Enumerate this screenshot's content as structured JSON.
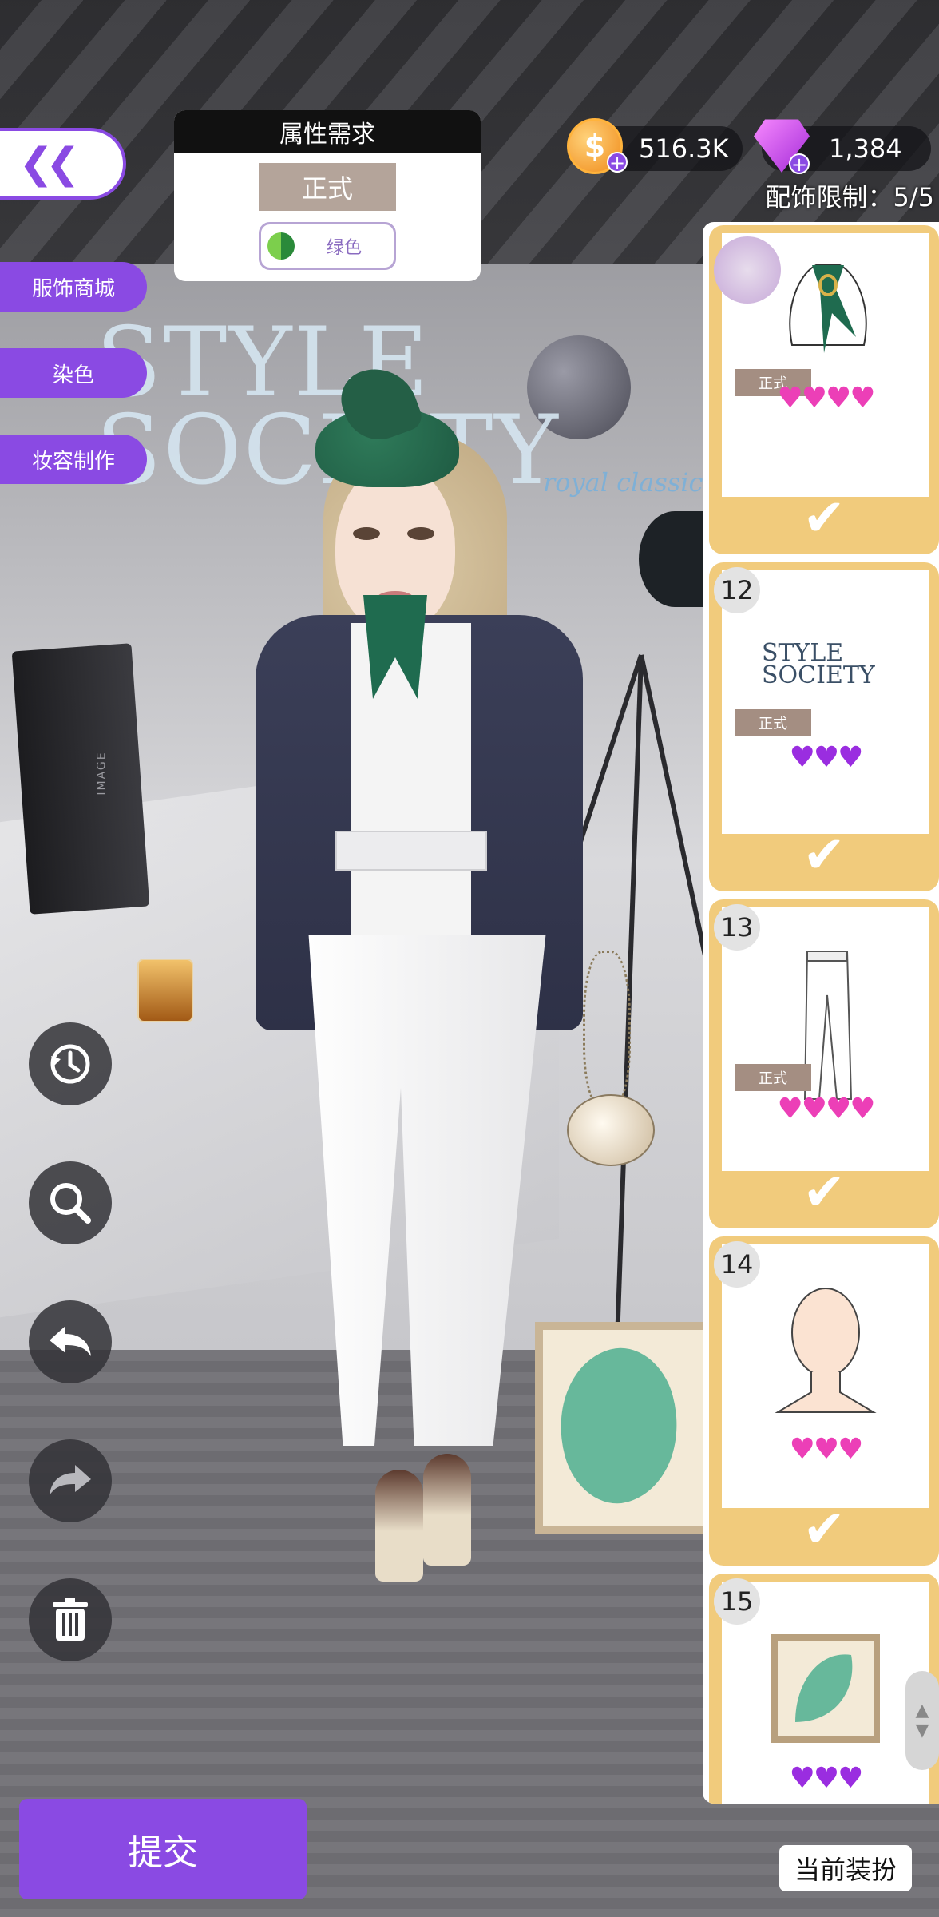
{
  "top_bar": {
    "coins": "516.3K",
    "gems": "1,384",
    "accessory_limit": "配饰限制：5/5"
  },
  "attribute_panel": {
    "title": "属性需求",
    "style_tag": "正式",
    "color_label": "绿色"
  },
  "side_menu": {
    "shop": "服饰商城",
    "dye": "染色",
    "makeup": "妆容制作"
  },
  "background": {
    "logo_line1": "STYLE",
    "logo_line2": "SOCIETY",
    "logo_script": "royal classic",
    "softbox_label": "IMAGE"
  },
  "items": [
    {
      "number": "",
      "tag": "正式",
      "hearts": "♥♥♥♥",
      "heart_color": "pink",
      "selected": true,
      "icon": "scarf-icon"
    },
    {
      "number": "12",
      "tag": "正式",
      "hearts": "♥♥♥",
      "heart_color": "purple",
      "selected": true,
      "icon": "style-society-backdrop-icon"
    },
    {
      "number": "13",
      "tag": "正式",
      "hearts": "♥♥♥♥",
      "heart_color": "pink",
      "selected": true,
      "icon": "white-pants-icon"
    },
    {
      "number": "14",
      "tag": "",
      "hearts": "♥♥♥",
      "heart_color": "pink",
      "selected": true,
      "icon": "head-makeup-icon"
    },
    {
      "number": "15",
      "tag": "",
      "hearts": "♥♥♥",
      "heart_color": "purple",
      "selected": false,
      "icon": "leaf-frame-icon"
    }
  ],
  "buttons": {
    "submit": "提交",
    "current_outfit": "当前装扮",
    "check_mark": "✔"
  }
}
